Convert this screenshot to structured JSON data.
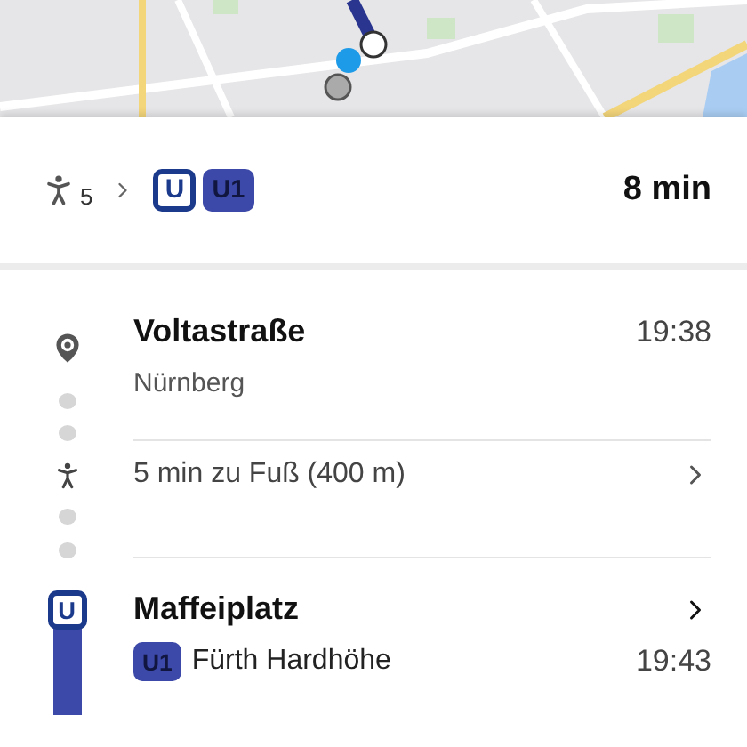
{
  "summary": {
    "walk_minutes": "5",
    "logo": "U",
    "line": "U1",
    "duration": "8 min"
  },
  "steps": [
    {
      "kind": "stop",
      "name": "Voltastraße",
      "place": "Nürnberg",
      "time": "19:38"
    },
    {
      "kind": "walk",
      "text": "5 min zu Fuß (400 m)"
    },
    {
      "kind": "station",
      "name": "Maffeiplatz",
      "logo": "U",
      "line": "U1",
      "direction": "Fürth Hardhöhe",
      "time": "19:43"
    }
  ]
}
